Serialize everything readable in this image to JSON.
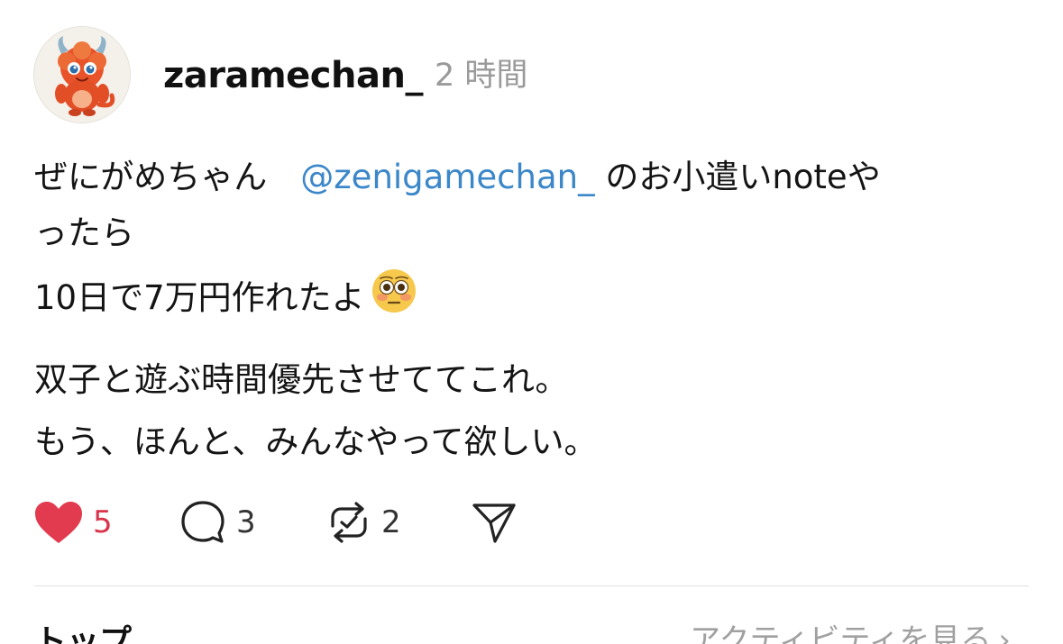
{
  "post": {
    "username": "zaramechan_",
    "time": "2 時間",
    "line1_prefix": "ぜにがめちゃん　",
    "mention": "@zenigamechan_",
    "line1_suffix": " のお小遣いnoteや",
    "line2": "ったら",
    "line3": "10日で7万円作れたよ",
    "line3_emoji": "flushed-face-emoji",
    "line4": "双子と遊ぶ時間優先させててこれ。",
    "line5": "もう、ほんと、みんなやって欲しい。"
  },
  "actions": {
    "like_count": "5",
    "comment_count": "3",
    "repost_count": "2",
    "icons": [
      "heart-icon",
      "comment-icon",
      "repost-icon",
      "share-icon"
    ]
  },
  "footer": {
    "left_label": "トップ",
    "left_chevron": "⌄",
    "right_label": "アクティビティを見る",
    "right_chevron": "›"
  },
  "colors": {
    "mention": "#3b87c9",
    "like": "#d8344b",
    "time": "#9a9a9a"
  }
}
